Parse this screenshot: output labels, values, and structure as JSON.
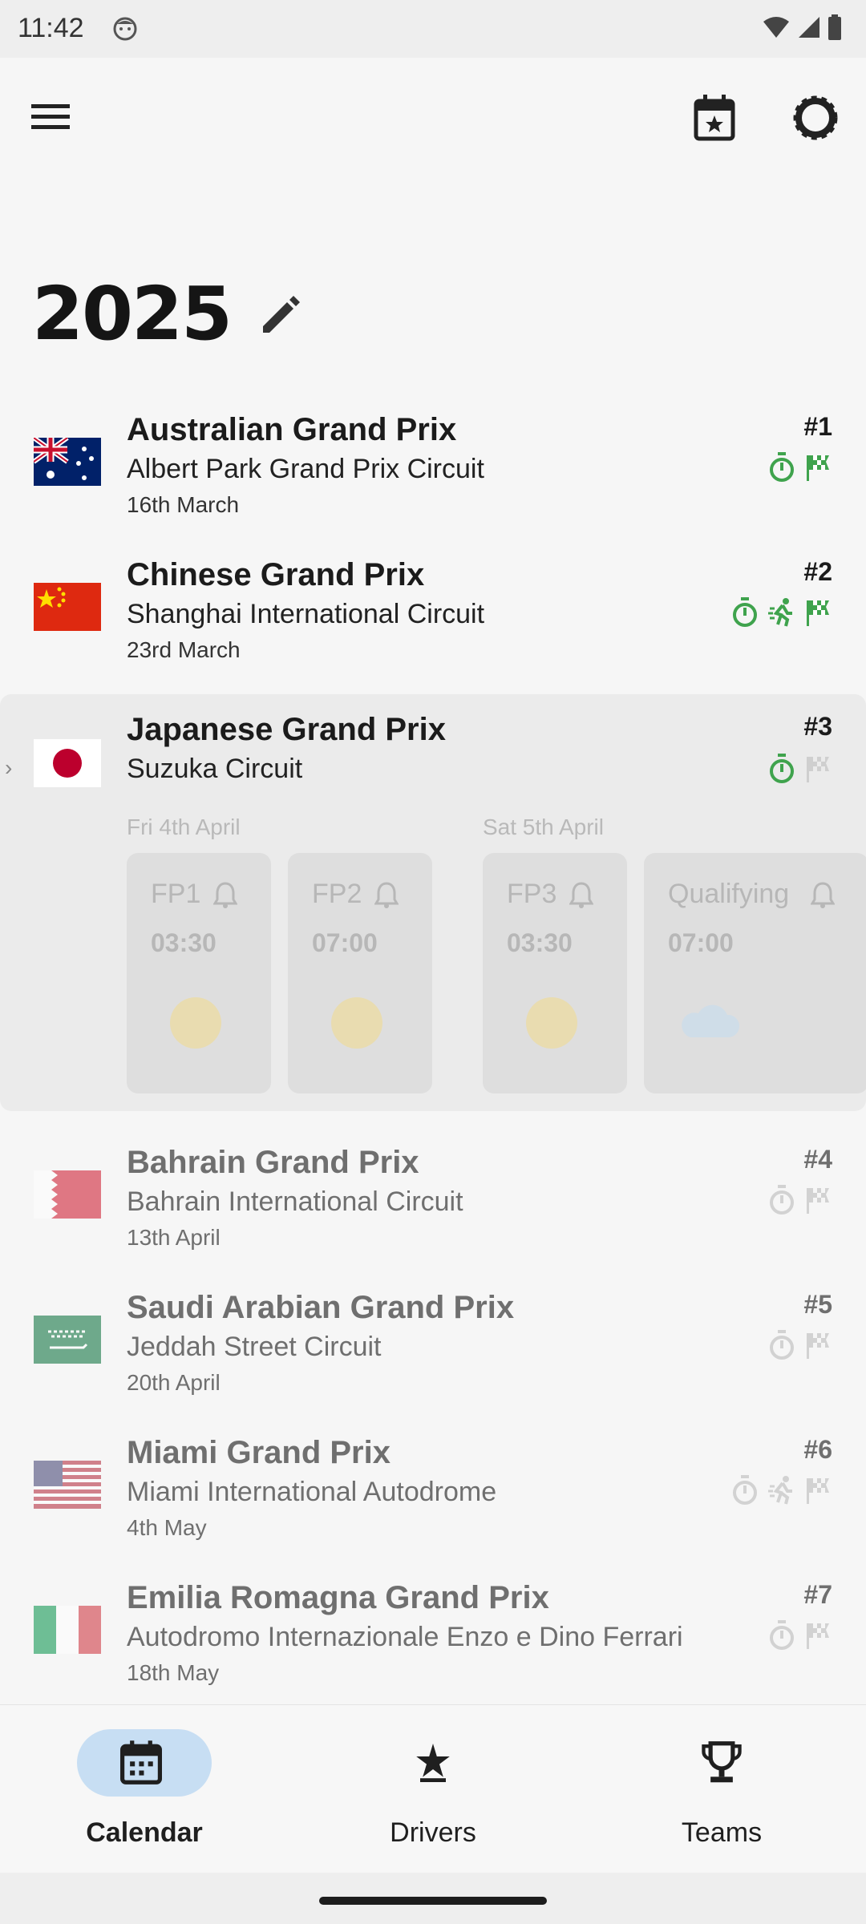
{
  "status_bar": {
    "time": "11:42"
  },
  "season": {
    "year": "2025"
  },
  "races": [
    {
      "name": "Australian Grand Prix",
      "circuit": "Albert Park Grand Prix Circuit",
      "date": "16th March",
      "round": "#1",
      "flag": "australia-flag",
      "badges": [
        "stopwatch-icon",
        "checkered-flag-icon"
      ]
    },
    {
      "name": "Chinese Grand Prix",
      "circuit": "Shanghai International Circuit",
      "date": "23rd March",
      "round": "#2",
      "flag": "china-flag",
      "badges": [
        "stopwatch-icon",
        "sprint-icon",
        "checkered-flag-icon"
      ]
    },
    {
      "name": "Japanese Grand Prix",
      "circuit": "Suzuka Circuit",
      "round": "#3",
      "flag": "japan-flag",
      "expanded": true,
      "badges": [
        "stopwatch-icon",
        "checkered-flag-icon"
      ]
    },
    {
      "name": "Bahrain Grand Prix",
      "circuit": "Bahrain International Circuit",
      "date": "13th April",
      "round": "#4",
      "flag": "bahrain-flag",
      "badges": [
        "stopwatch-icon",
        "checkered-flag-icon"
      ]
    },
    {
      "name": "Saudi Arabian Grand Prix",
      "circuit": "Jeddah Street Circuit",
      "date": "20th April",
      "round": "#5",
      "flag": "saudi-arabia-flag",
      "badges": [
        "stopwatch-icon",
        "checkered-flag-icon"
      ]
    },
    {
      "name": "Miami Grand Prix",
      "circuit": "Miami International Autodrome",
      "date": "4th May",
      "round": "#6",
      "flag": "usa-flag",
      "badges": [
        "stopwatch-icon",
        "sprint-icon",
        "checkered-flag-icon"
      ]
    },
    {
      "name": "Emilia Romagna Grand Prix",
      "circuit": "Autodromo Internazionale Enzo e Dino Ferrari",
      "date": "18th May",
      "round": "#7",
      "flag": "italy-flag",
      "badges": [
        "stopwatch-icon",
        "checkered-flag-icon"
      ]
    }
  ],
  "japan_schedule": {
    "days": [
      "Fri 4th April",
      "Sat 5th April"
    ],
    "sessions": [
      {
        "name": "FP1",
        "time": "03:30",
        "weather": "sun-icon"
      },
      {
        "name": "FP2",
        "time": "07:00",
        "weather": "sun-icon"
      },
      {
        "name": "FP3",
        "time": "03:30",
        "weather": "sun-icon"
      },
      {
        "name": "Qualifying",
        "time": "07:00",
        "weather": "cloud-icon"
      }
    ]
  },
  "nav": {
    "calendar": "Calendar",
    "drivers": "Drivers",
    "teams": "Teams",
    "active": "calendar"
  },
  "colors": {
    "accent_green": "#3fa34d",
    "nav_pill": "#c7def3",
    "dim_icon": "#cfcfcf"
  }
}
